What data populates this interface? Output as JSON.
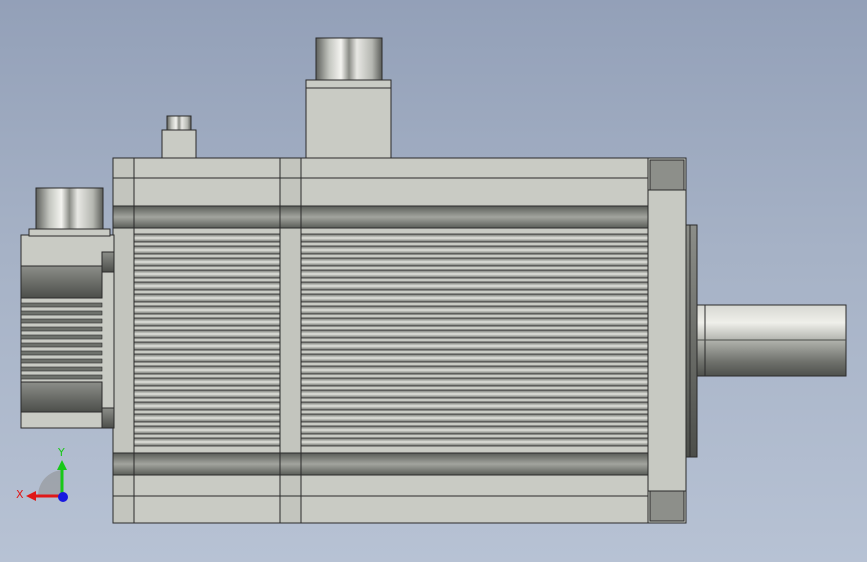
{
  "axes": {
    "x_label": "X",
    "y_label": "Y",
    "colors": {
      "x": "#e01818",
      "y": "#18c818",
      "z": "#1818e0"
    }
  },
  "model": {
    "view": "front",
    "body_color": "#c9cbc4",
    "edge_color": "#2a2a2a",
    "metal_color": "#a9aaa4",
    "dark_band_color": "#6e716c"
  }
}
